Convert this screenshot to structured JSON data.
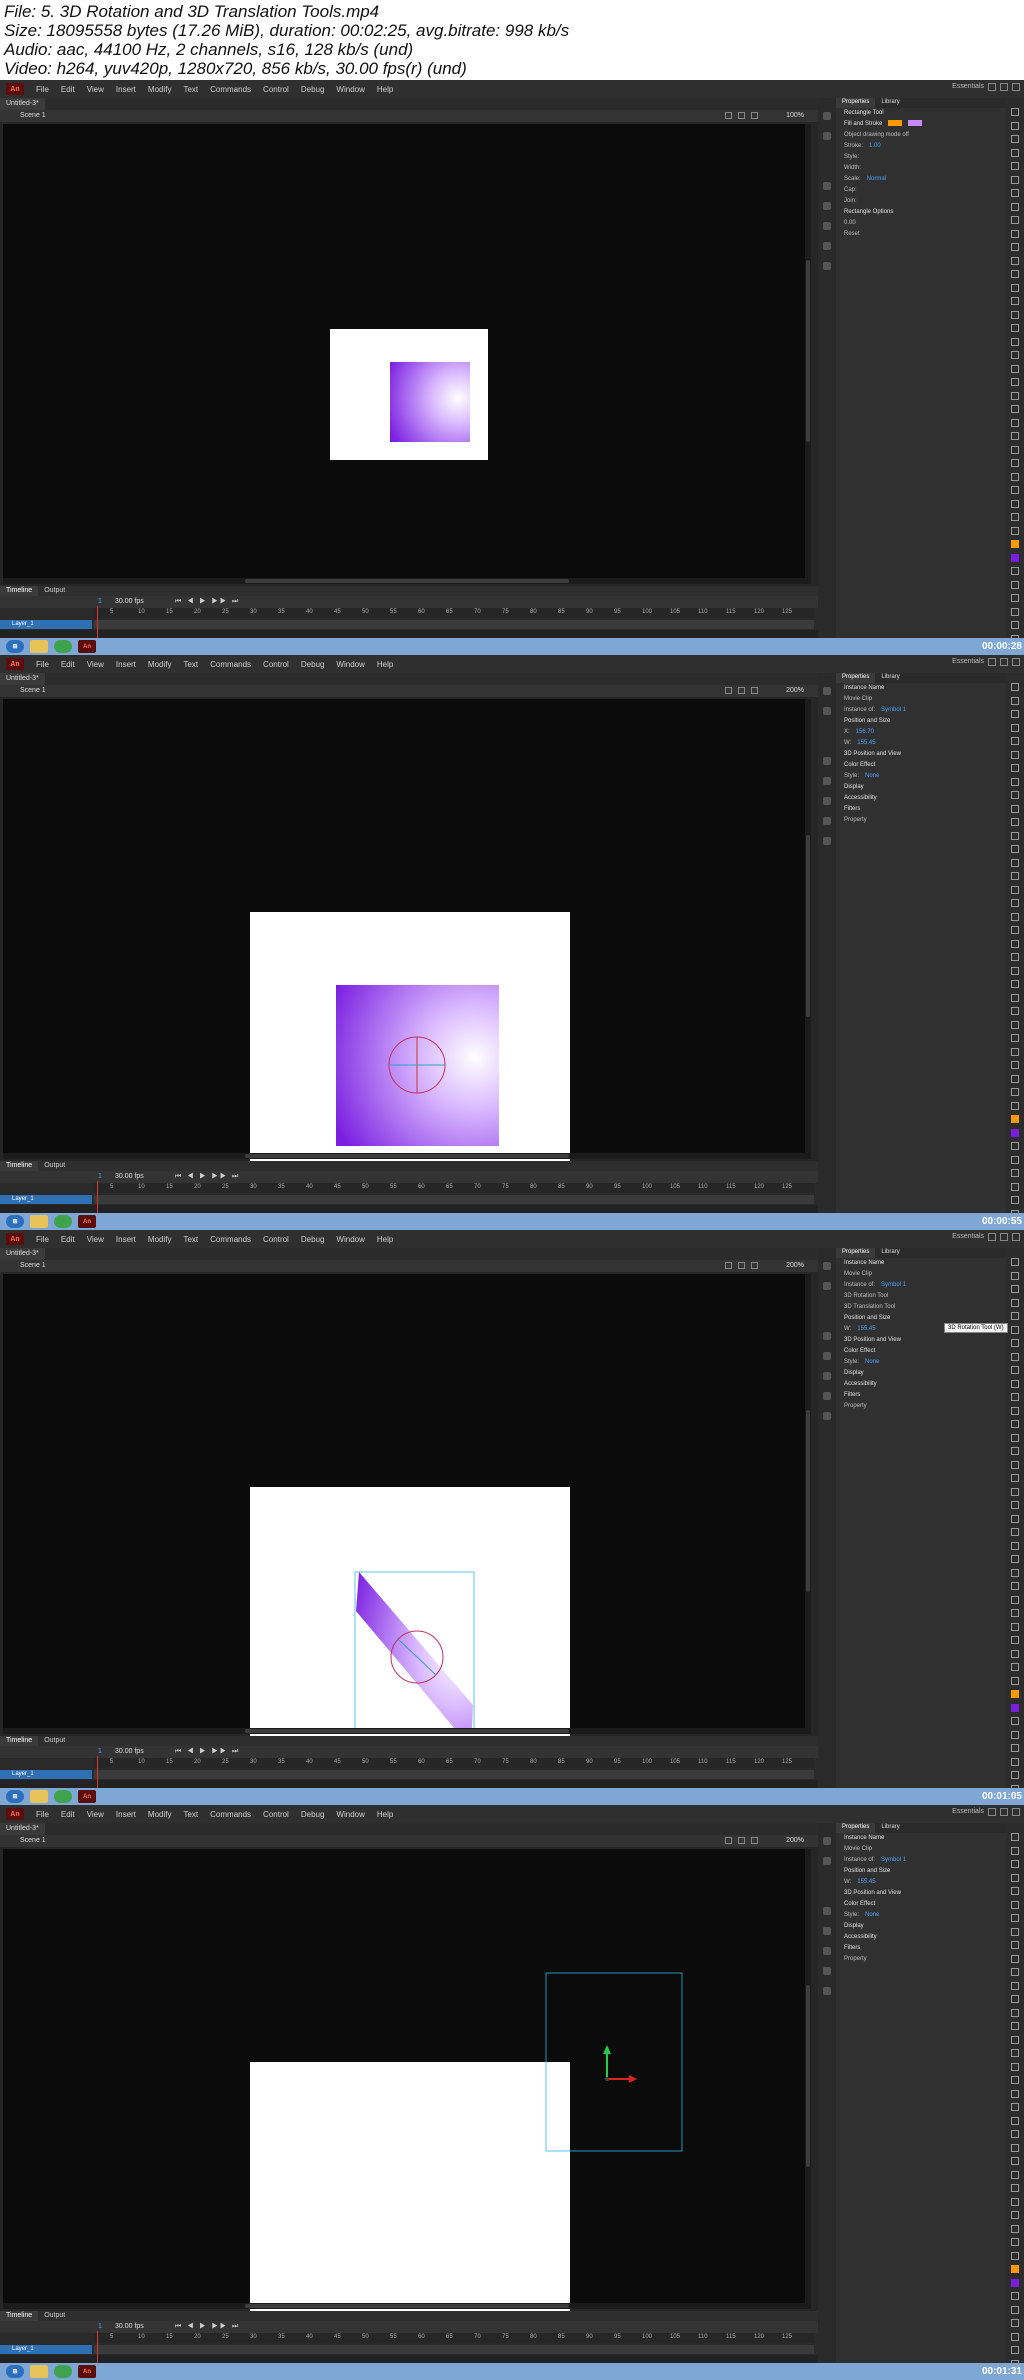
{
  "header": {
    "file": "File: 5. 3D Rotation and 3D Translation Tools.mp4",
    "size": "Size: 18095558 bytes (17.26 MiB), duration: 00:02:25, avg.bitrate: 998 kb/s",
    "audio": "Audio: aac, 44100 Hz, 2 channels, s16, 128 kb/s (und)",
    "video": "Video: h264, yuv420p, 1280x720, 856 kb/s, 30.00 fps(r) (und)"
  },
  "app": {
    "logo": "An",
    "menu": [
      "File",
      "Edit",
      "View",
      "Insert",
      "Modify",
      "Text",
      "Commands",
      "Control",
      "Debug",
      "Window",
      "Help"
    ],
    "workspace": "Essentials",
    "doc_tab": "Untitled-3*",
    "scene": "Scene 1",
    "timeline_tabs": [
      "Timeline",
      "Output"
    ],
    "layer_name": "Layer_1",
    "fps": "30.00 fps",
    "frame_number": "1",
    "ruler": [
      "5",
      "10",
      "15",
      "20",
      "25",
      "30",
      "35",
      "40",
      "45",
      "50",
      "55",
      "60",
      "65",
      "70",
      "75",
      "80",
      "85",
      "90",
      "95",
      "100",
      "105",
      "110",
      "115",
      "120",
      "125"
    ],
    "props_tabs": [
      "Properties",
      "Library"
    ]
  },
  "shots": [
    {
      "zoom": "100%",
      "timestamp": "00:00:28",
      "props": [
        {
          "kind": "title",
          "text": "Rectangle Tool"
        },
        {
          "kind": "sect",
          "text": "Fill and Stroke"
        },
        {
          "kind": "row",
          "text": "Object drawing mode off"
        },
        {
          "kind": "row",
          "text": "Stroke:",
          "val": "1.00"
        },
        {
          "kind": "row",
          "text": "Style:"
        },
        {
          "kind": "row",
          "text": "Width:"
        },
        {
          "kind": "row",
          "text": "Scale:",
          "val": "Normal"
        },
        {
          "kind": "row",
          "text": "Cap:"
        },
        {
          "kind": "row",
          "text": "Join:"
        },
        {
          "kind": "sect",
          "text": "Rectangle Options"
        },
        {
          "kind": "row",
          "text": "0.00"
        },
        {
          "kind": "row",
          "text": "Reset"
        }
      ]
    },
    {
      "zoom": "200%",
      "timestamp": "00:00:55",
      "props": [
        {
          "kind": "title",
          "text": "Instance Name"
        },
        {
          "kind": "row",
          "text": "Movie Clip"
        },
        {
          "kind": "row",
          "text": "Instance of:",
          "val": "Symbol 1"
        },
        {
          "kind": "sect",
          "text": "Position and Size"
        },
        {
          "kind": "row",
          "text": "X:",
          "val": "156.70"
        },
        {
          "kind": "row",
          "text": "W:",
          "val": "155.45"
        },
        {
          "kind": "sect",
          "text": "3D Position and View"
        },
        {
          "kind": "sect",
          "text": "Color Effect"
        },
        {
          "kind": "row",
          "text": "Style:",
          "val": "None"
        },
        {
          "kind": "sect",
          "text": "Display"
        },
        {
          "kind": "sect",
          "text": "Accessibility"
        },
        {
          "kind": "sect",
          "text": "Filters"
        },
        {
          "kind": "row",
          "text": "Property"
        }
      ]
    },
    {
      "zoom": "200%",
      "timestamp": "00:01:05",
      "tooltip": "3D Rotation Tool (W)",
      "props": [
        {
          "kind": "title",
          "text": "Instance Name"
        },
        {
          "kind": "row",
          "text": "Movie Clip"
        },
        {
          "kind": "row",
          "text": "Instance of:",
          "val": "Symbol 1"
        },
        {
          "kind": "row",
          "text": "3D Rotation Tool"
        },
        {
          "kind": "row",
          "text": "3D Translation Tool"
        },
        {
          "kind": "sect",
          "text": "Position and Size"
        },
        {
          "kind": "row",
          "text": "W:",
          "val": "155.45"
        },
        {
          "kind": "sect",
          "text": "3D Position and View"
        },
        {
          "kind": "sect",
          "text": "Color Effect"
        },
        {
          "kind": "row",
          "text": "Style:",
          "val": "None"
        },
        {
          "kind": "sect",
          "text": "Display"
        },
        {
          "kind": "sect",
          "text": "Accessibility"
        },
        {
          "kind": "sect",
          "text": "Filters"
        },
        {
          "kind": "row",
          "text": "Property"
        }
      ]
    },
    {
      "zoom": "200%",
      "timestamp": "00:01:31",
      "props": [
        {
          "kind": "title",
          "text": "Instance Name"
        },
        {
          "kind": "row",
          "text": "Movie Clip"
        },
        {
          "kind": "row",
          "text": "Instance of:",
          "val": "Symbol 1"
        },
        {
          "kind": "sect",
          "text": "Position and Size"
        },
        {
          "kind": "row",
          "text": "W:",
          "val": "155.45"
        },
        {
          "kind": "sect",
          "text": "3D Position and View"
        },
        {
          "kind": "sect",
          "text": "Color Effect"
        },
        {
          "kind": "row",
          "text": "Style:",
          "val": "None"
        },
        {
          "kind": "sect",
          "text": "Display"
        },
        {
          "kind": "sect",
          "text": "Accessibility"
        },
        {
          "kind": "sect",
          "text": "Filters"
        },
        {
          "kind": "row",
          "text": "Property"
        }
      ]
    }
  ],
  "colors": {
    "accent": "#4aa3ff",
    "purple": "#7a1fe0",
    "taskbar": "#7fa7d6",
    "stage_bg": "#0b0b0b",
    "panel": "#303030"
  }
}
